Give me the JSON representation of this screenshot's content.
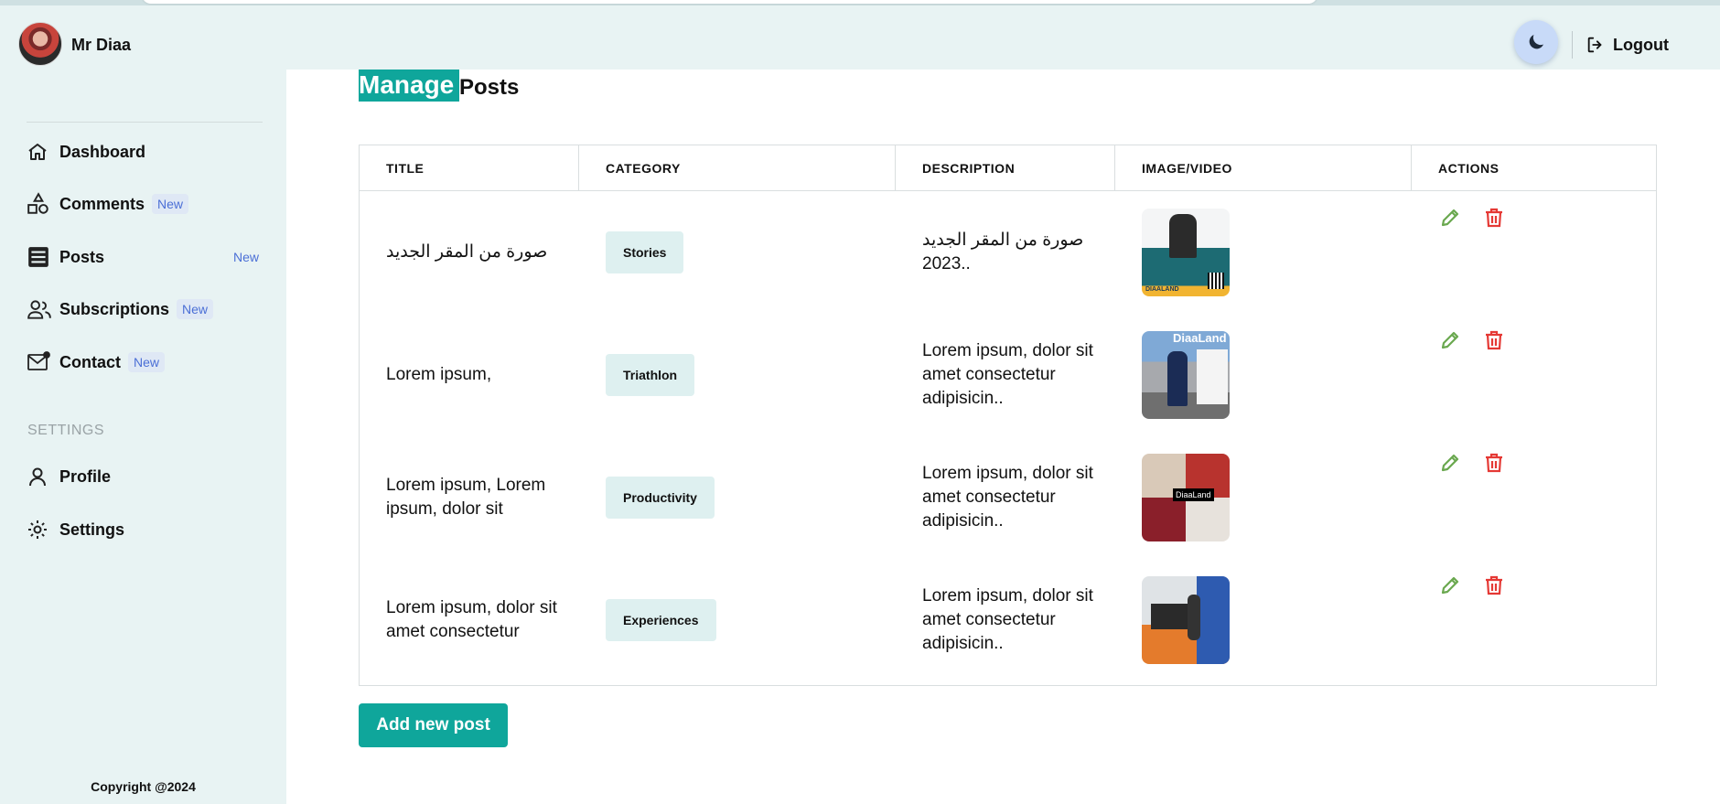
{
  "user": {
    "name": "Mr Diaa"
  },
  "header": {
    "logout_label": "Logout"
  },
  "sidebar": {
    "items": [
      {
        "label": "Dashboard",
        "icon": "home-icon",
        "badge": ""
      },
      {
        "label": "Comments",
        "icon": "shapes-icon",
        "badge": "New"
      },
      {
        "label": "Posts",
        "icon": "posts-icon",
        "badge": "New"
      },
      {
        "label": "Subscriptions",
        "icon": "users-icon",
        "badge": "New"
      },
      {
        "label": "Contact",
        "icon": "mail-icon",
        "badge": "New"
      }
    ],
    "settings_section": "SETTINGS",
    "settings_items": [
      {
        "label": "Profile",
        "icon": "user-icon"
      },
      {
        "label": "Settings",
        "icon": "gear-icon"
      }
    ],
    "copyright": "Copyright @2024"
  },
  "page": {
    "title_highlight": "Manage",
    "title_rest": "Posts"
  },
  "table": {
    "columns": [
      "TITLE",
      "CATEGORY",
      "DESCRIPTION",
      "IMAGE/VIDEO",
      "ACTIONS"
    ],
    "rows": [
      {
        "title": "صورة من المقر الجديد",
        "category": "Stories",
        "description": "صورة من المقر الجديد 2023.."
      },
      {
        "title": "Lorem ipsum,",
        "category": "Triathlon",
        "description": "Lorem ipsum, dolor sit amet consectetur adipisicin.."
      },
      {
        "title": "Lorem ipsum, Lorem ipsum, dolor sit",
        "category": "Productivity",
        "description": "Lorem ipsum, dolor sit amet consectetur adipisicin.."
      },
      {
        "title": "Lorem ipsum, dolor sit amet consectetur",
        "category": "Experiences",
        "description": "Lorem ipsum, dolor sit amet consectetur adipisicin.."
      }
    ],
    "thumb_texts": [
      "DIAALAND",
      "DiaaLand",
      "DiaaLand",
      ""
    ]
  },
  "add_button_label": "Add new post",
  "colors": {
    "accent": "#0fa69b",
    "edit": "#6aa84f",
    "delete": "#e53935",
    "badge": "#4b6fd6"
  }
}
